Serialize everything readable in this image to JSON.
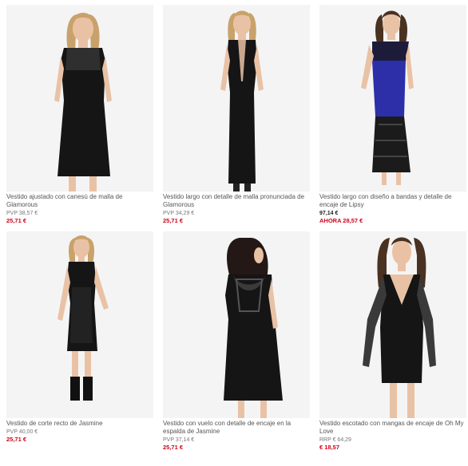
{
  "products": [
    {
      "title": "Vestido ajustado con canesú de malla de Glamorous",
      "price_label": "PVP 38,57 €",
      "price_now": "25,71 €"
    },
    {
      "title": "Vestido largo con detalle de malla pronunciada de Glamorous",
      "price_label": "PVP 34,29 €",
      "price_now": "25,71 €"
    },
    {
      "title": "Vestido largo con diseño a bandas y detalle de encaje de Lipsy",
      "price_label": "97,14 €",
      "price_now": "AHORA 28,57 €"
    },
    {
      "title": "Vestido de corte recto de Jasmine",
      "price_label": "PVP 40,00 €",
      "price_now": "25,71 €"
    },
    {
      "title": "Vestido con vuelo con detalle de encaje en la espalda de Jasmine",
      "price_label": "PVP 37,14 €",
      "price_now": "25,71 €"
    },
    {
      "title": "Vestido escotado con mangas de encaje de Oh My Love",
      "price_label": "RRP € 64,29",
      "price_now": "€ 18,57"
    }
  ],
  "colors": {
    "sale": "#d0021b",
    "dress_black": "#151515",
    "dress_blue": "#2c2fa8",
    "skin": "#e9c2a6",
    "hair_blonde": "#c9a26b",
    "hair_brown": "#4a3222",
    "photo_bg": "#f4f4f4"
  }
}
